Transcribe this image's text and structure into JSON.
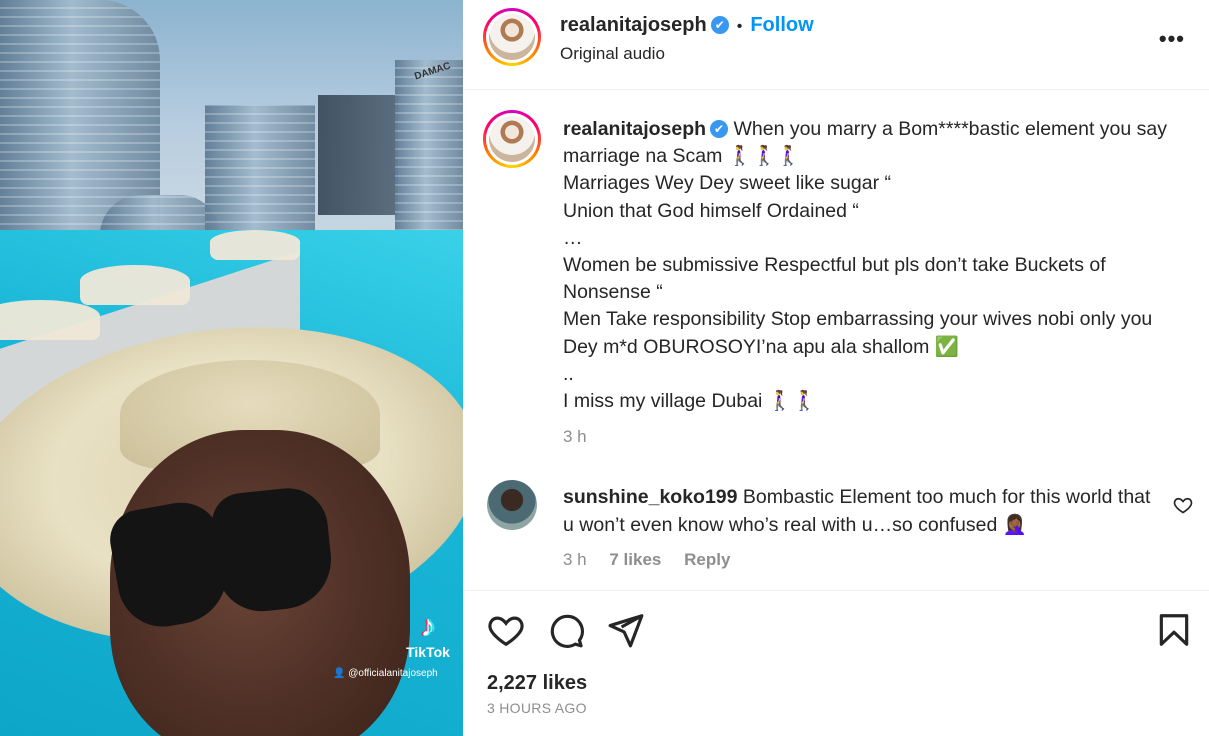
{
  "media": {
    "tiktok_label": "TikTok",
    "tiktok_user": "@officialanitajoseph",
    "building_sign": "DAMAC"
  },
  "header": {
    "username": "realanitajoseph",
    "verified_icon": "✔",
    "separator": "•",
    "follow_label": "Follow",
    "subtitle": "Original audio",
    "more_label": "•••"
  },
  "caption": {
    "username": "realanitajoseph",
    "lines": [
      "When you marry a Bom****bastic element you say marriage na Scam 🚶‍♀️🚶‍♀️🚶‍♀️",
      "Marriages Wey Dey sweet like sugar “",
      "Union that God himself Ordained “",
      "…",
      "Women be submissive Respectful but pls don’t take Buckets of Nonsense “",
      "Men Take responsibility Stop embarrassing your wives nobi only you Dey m*d OBUROSOYI’na apu ala shallom ✅",
      "..",
      "I miss my village Dubai 🚶‍♀️🚶‍♀️"
    ],
    "time": "3 h"
  },
  "comment": {
    "username": "sunshine_koko199",
    "text": "Bombastic Element too much for this world that u won’t even know who’s real with u…so confused 🤦🏾‍♀️",
    "time": "3 h",
    "likes": "7 likes",
    "reply_label": "Reply"
  },
  "footer": {
    "likes": "2,227 likes",
    "posted": "3 HOURS AGO"
  },
  "colors": {
    "accent": "#0095f6",
    "verified": "#3897f0",
    "muted": "#8e8e8e",
    "text": "#262626"
  }
}
